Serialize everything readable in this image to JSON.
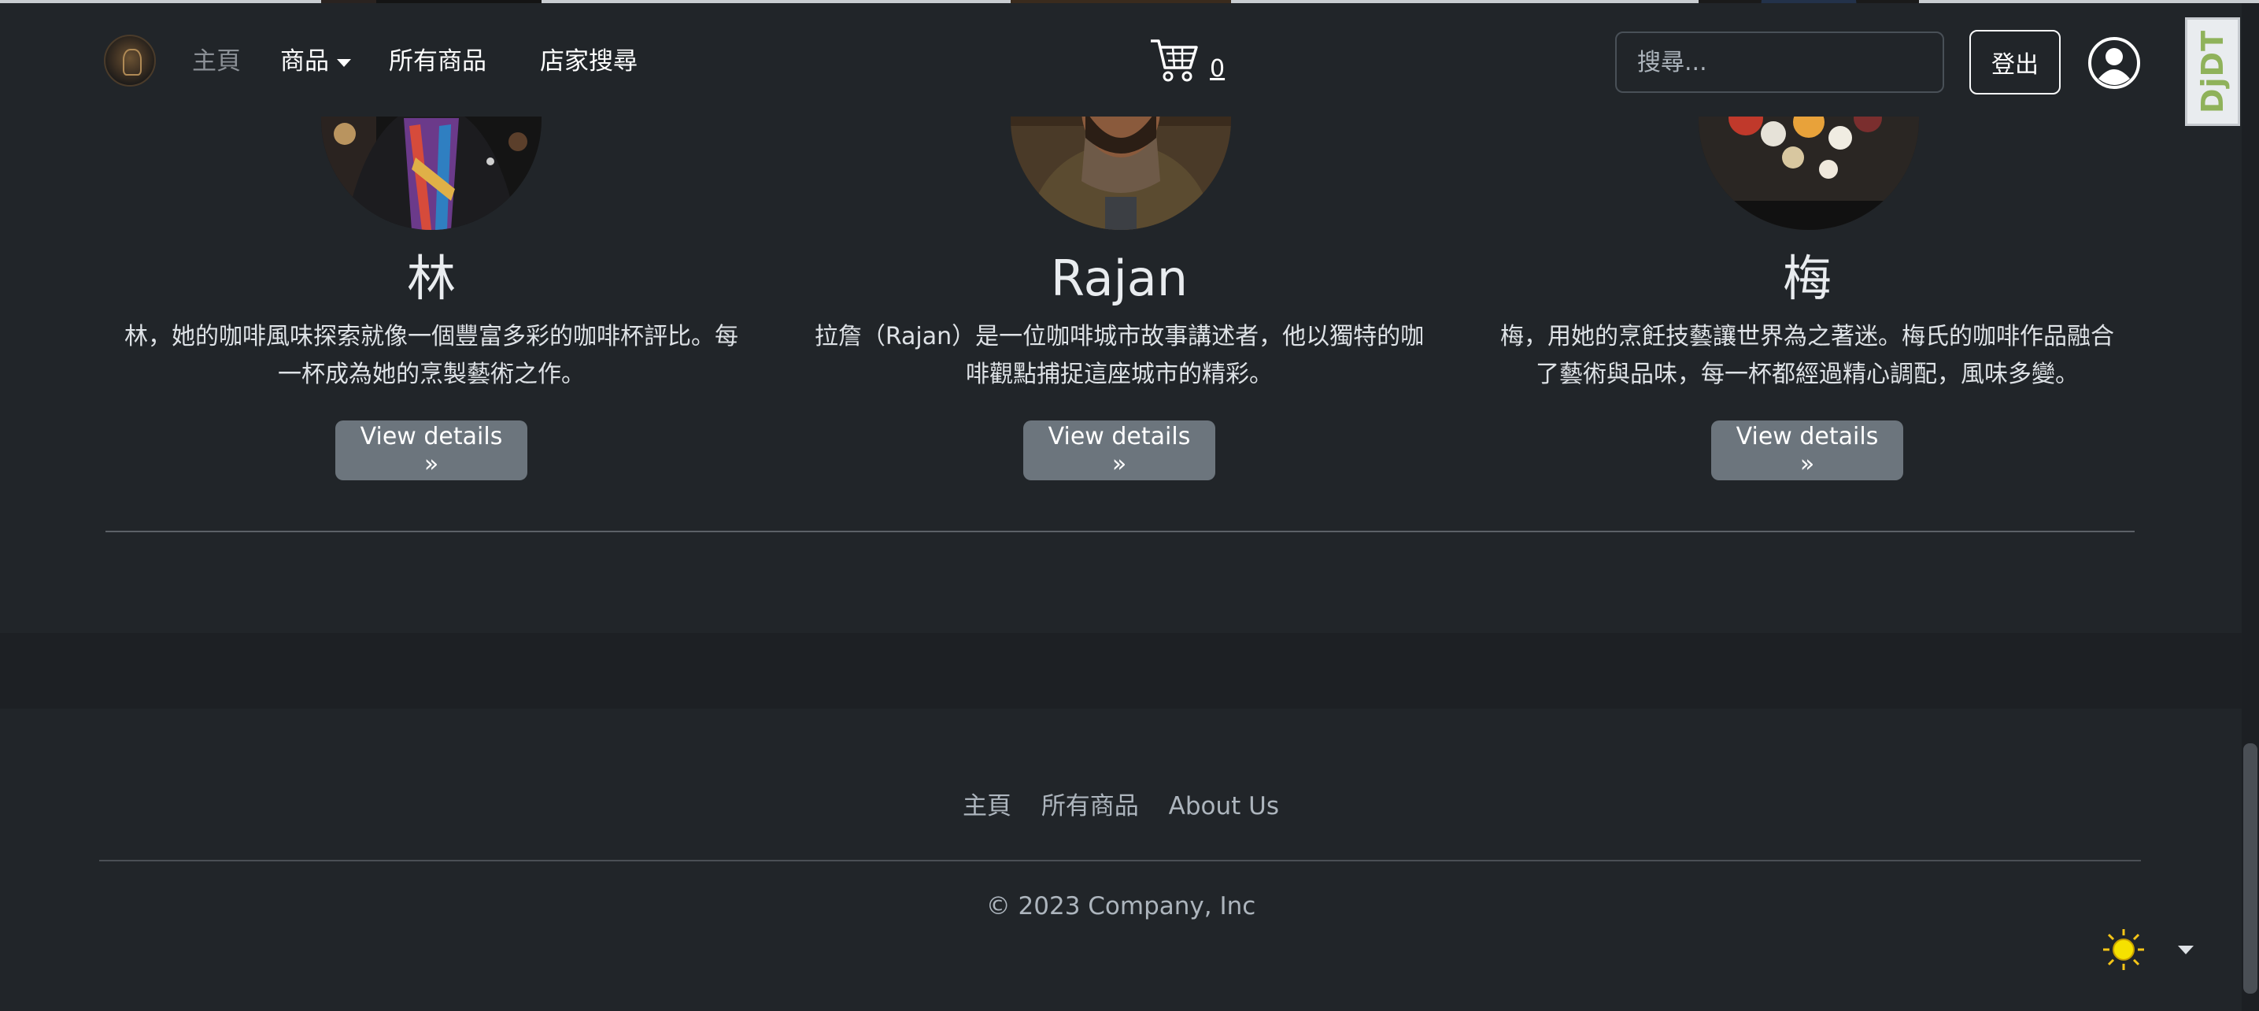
{
  "navbar": {
    "home": "主頁",
    "products": "商品",
    "all_products": "所有商品",
    "store_search": "店家搜尋",
    "cart_count": "0",
    "search_placeholder": "搜尋...",
    "logout": "登出"
  },
  "cards": [
    {
      "name": "林",
      "desc": "林，她的咖啡風味探索就像一個豐富多彩的咖啡杯評比。每一杯成為她的烹製藝術之作。",
      "button": "View details »"
    },
    {
      "name": "Rajan",
      "desc": "拉詹（Rajan）是一位咖啡城市故事講述者，他以獨特的咖啡觀點捕捉這座城市的精彩。",
      "button": "View details »"
    },
    {
      "name": "梅",
      "desc": "梅，用她的烹飪技藝讓世界為之著迷。梅氏的咖啡作品融合了藝術與品味，每一杯都經過精心調配，風味多變。",
      "button": "View details »"
    }
  ],
  "footer": {
    "links": [
      "主頁",
      "所有商品",
      "About Us"
    ],
    "copyright": "© 2023 Company, Inc"
  },
  "debug_toolbar": {
    "label": "DjDT"
  },
  "icons": {
    "cart": "cart-icon",
    "user": "user-circle-icon",
    "theme": "sun-icon"
  },
  "colors": {
    "background": "#212529",
    "button": "#6c757d",
    "footer_band": "#1d2024",
    "djdt_green": "#8fb25a"
  }
}
